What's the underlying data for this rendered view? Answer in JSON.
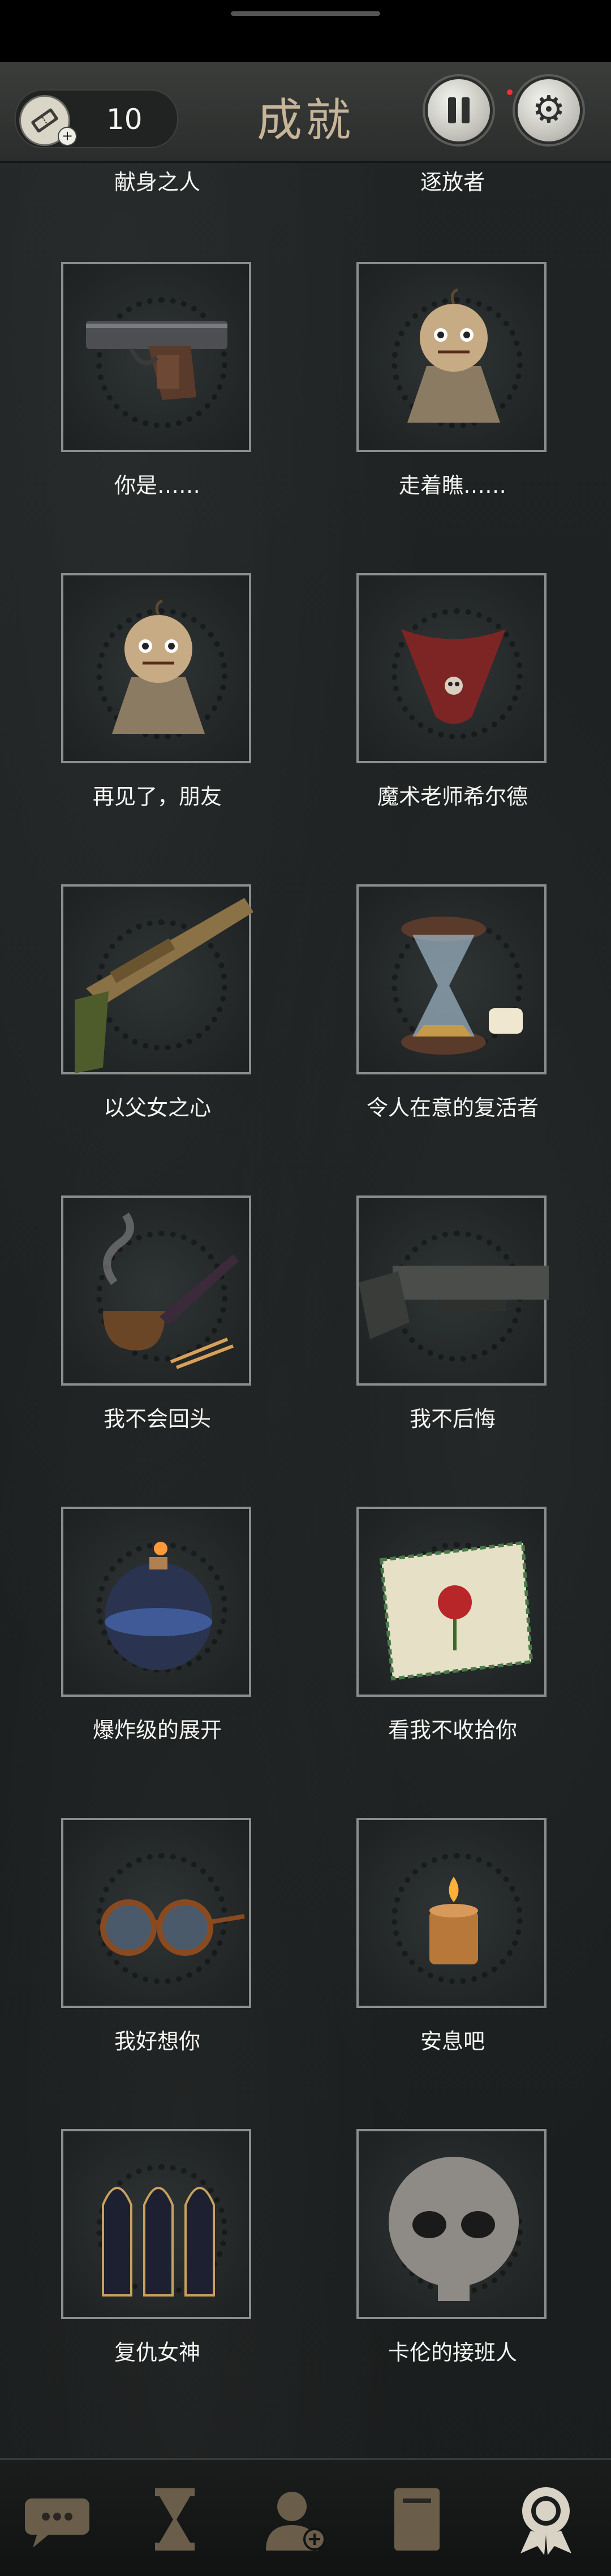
{
  "header": {
    "title": "成就",
    "ticket_count": "10"
  },
  "achievements": [
    {
      "label": "献身之人"
    },
    {
      "label": "逐放者"
    },
    {
      "label": "你是……"
    },
    {
      "label": "走着瞧……"
    },
    {
      "label": "再见了，朋友"
    },
    {
      "label": "魔术老师希尔德"
    },
    {
      "label": "以父女之心"
    },
    {
      "label": "令人在意的复活者"
    },
    {
      "label": "我不会回头"
    },
    {
      "label": "我不后悔"
    },
    {
      "label": "爆炸级的展开"
    },
    {
      "label": "看我不收拾你"
    },
    {
      "label": "我好想你"
    },
    {
      "label": "安息吧"
    },
    {
      "label": "复仇女神"
    },
    {
      "label": "卡伦的接班人"
    }
  ],
  "icons": {
    "ticket": "ticket-icon",
    "pause": "pause-icon",
    "settings": "gear-icon",
    "tabs": [
      "chat-icon",
      "hourglass-icon",
      "add-contact-icon",
      "book-icon",
      "medal-icon"
    ]
  },
  "colors": {
    "title": "#c7b59a",
    "background": "#1d2020",
    "card_border": "#8a8f8d",
    "tab_active": "#d9d3c6",
    "tab_inactive": "#6a5e4a"
  }
}
